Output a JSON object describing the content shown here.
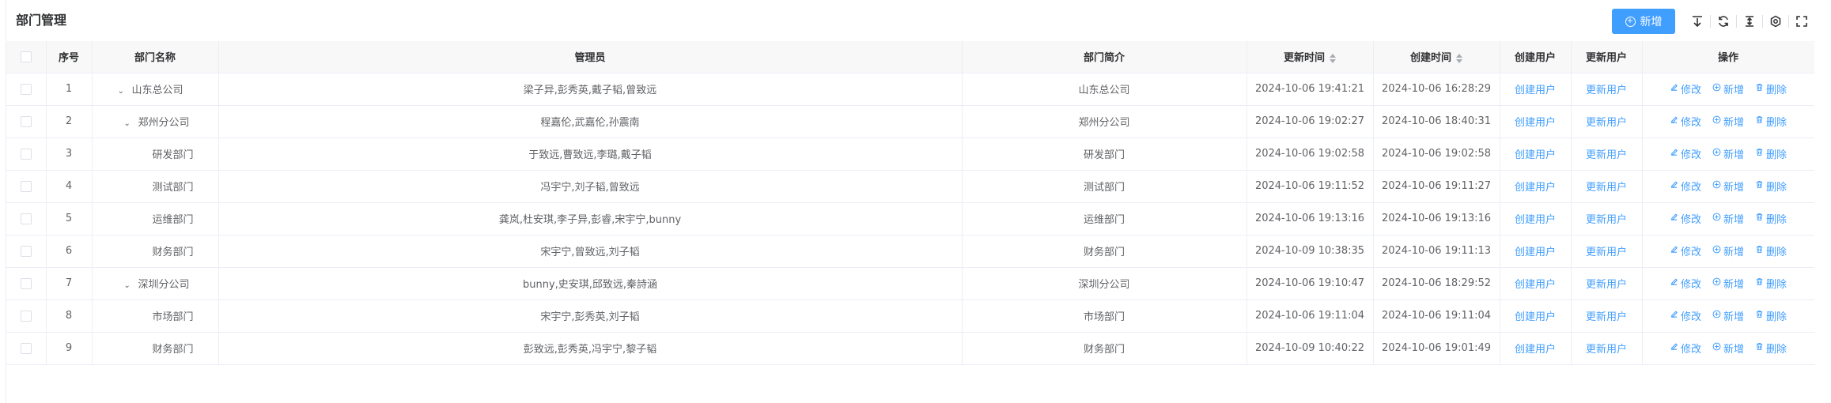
{
  "page": {
    "title": "部门管理"
  },
  "toolbar": {
    "add_label": "新增",
    "icons": [
      "export-icon",
      "refresh-icon",
      "expand-collapse-icon",
      "settings-icon",
      "fullscreen-icon"
    ]
  },
  "table": {
    "headers": {
      "index": "序号",
      "name": "部门名称",
      "managers": "管理员",
      "desc": "部门简介",
      "updated": "更新时间",
      "created": "创建时间",
      "create_user": "创建用户",
      "update_user": "更新用户",
      "ops": "操作"
    },
    "op_labels": {
      "edit": "修改",
      "add": "新增",
      "delete": "删除"
    },
    "rows": [
      {
        "index": "1",
        "name": "山东总公司",
        "level": 0,
        "expandable": true,
        "managers": "梁子异,彭秀英,戴子韬,曾致远",
        "desc": "山东总公司",
        "updated": "2024-10-06 19:41:21",
        "created": "2024-10-06 16:28:29",
        "create_user": "创建用户",
        "update_user": "更新用户"
      },
      {
        "index": "2",
        "name": "郑州分公司",
        "level": 1,
        "expandable": true,
        "managers": "程嘉伦,武嘉伦,孙震南",
        "desc": "郑州分公司",
        "updated": "2024-10-06 19:02:27",
        "created": "2024-10-06 18:40:31",
        "create_user": "创建用户",
        "update_user": "更新用户"
      },
      {
        "index": "3",
        "name": "研发部门",
        "level": 2,
        "expandable": false,
        "managers": "于致远,曹致远,李璐,戴子韬",
        "desc": "研发部门",
        "updated": "2024-10-06 19:02:58",
        "created": "2024-10-06 19:02:58",
        "create_user": "创建用户",
        "update_user": "更新用户"
      },
      {
        "index": "4",
        "name": "测试部门",
        "level": 2,
        "expandable": false,
        "managers": "冯宇宁,刘子韬,曾致远",
        "desc": "测试部门",
        "updated": "2024-10-06 19:11:52",
        "created": "2024-10-06 19:11:27",
        "create_user": "创建用户",
        "update_user": "更新用户"
      },
      {
        "index": "5",
        "name": "运维部门",
        "level": 2,
        "expandable": false,
        "managers": "龚岚,杜安琪,李子异,彭睿,宋宇宁,bunny",
        "desc": "运维部门",
        "updated": "2024-10-06 19:13:16",
        "created": "2024-10-06 19:13:16",
        "create_user": "创建用户",
        "update_user": "更新用户"
      },
      {
        "index": "6",
        "name": "财务部门",
        "level": 2,
        "expandable": false,
        "managers": "宋宇宁,曾致远,刘子韬",
        "desc": "财务部门",
        "updated": "2024-10-09 10:38:35",
        "created": "2024-10-06 19:11:13",
        "create_user": "创建用户",
        "update_user": "更新用户"
      },
      {
        "index": "7",
        "name": "深圳分公司",
        "level": 1,
        "expandable": true,
        "managers": "bunny,史安琪,邱致远,秦詩涵",
        "desc": "深圳分公司",
        "updated": "2024-10-06 19:10:47",
        "created": "2024-10-06 18:29:52",
        "create_user": "创建用户",
        "update_user": "更新用户"
      },
      {
        "index": "8",
        "name": "市场部门",
        "level": 2,
        "expandable": false,
        "managers": "宋宇宁,彭秀英,刘子韬",
        "desc": "市场部门",
        "updated": "2024-10-06 19:11:04",
        "created": "2024-10-06 19:11:04",
        "create_user": "创建用户",
        "update_user": "更新用户"
      },
      {
        "index": "9",
        "name": "财务部门",
        "level": 2,
        "expandable": false,
        "managers": "彭致远,彭秀英,冯宇宁,黎子韬",
        "desc": "财务部门",
        "updated": "2024-10-09 10:40:22",
        "created": "2024-10-06 19:01:49",
        "create_user": "创建用户",
        "update_user": "更新用户"
      }
    ]
  }
}
